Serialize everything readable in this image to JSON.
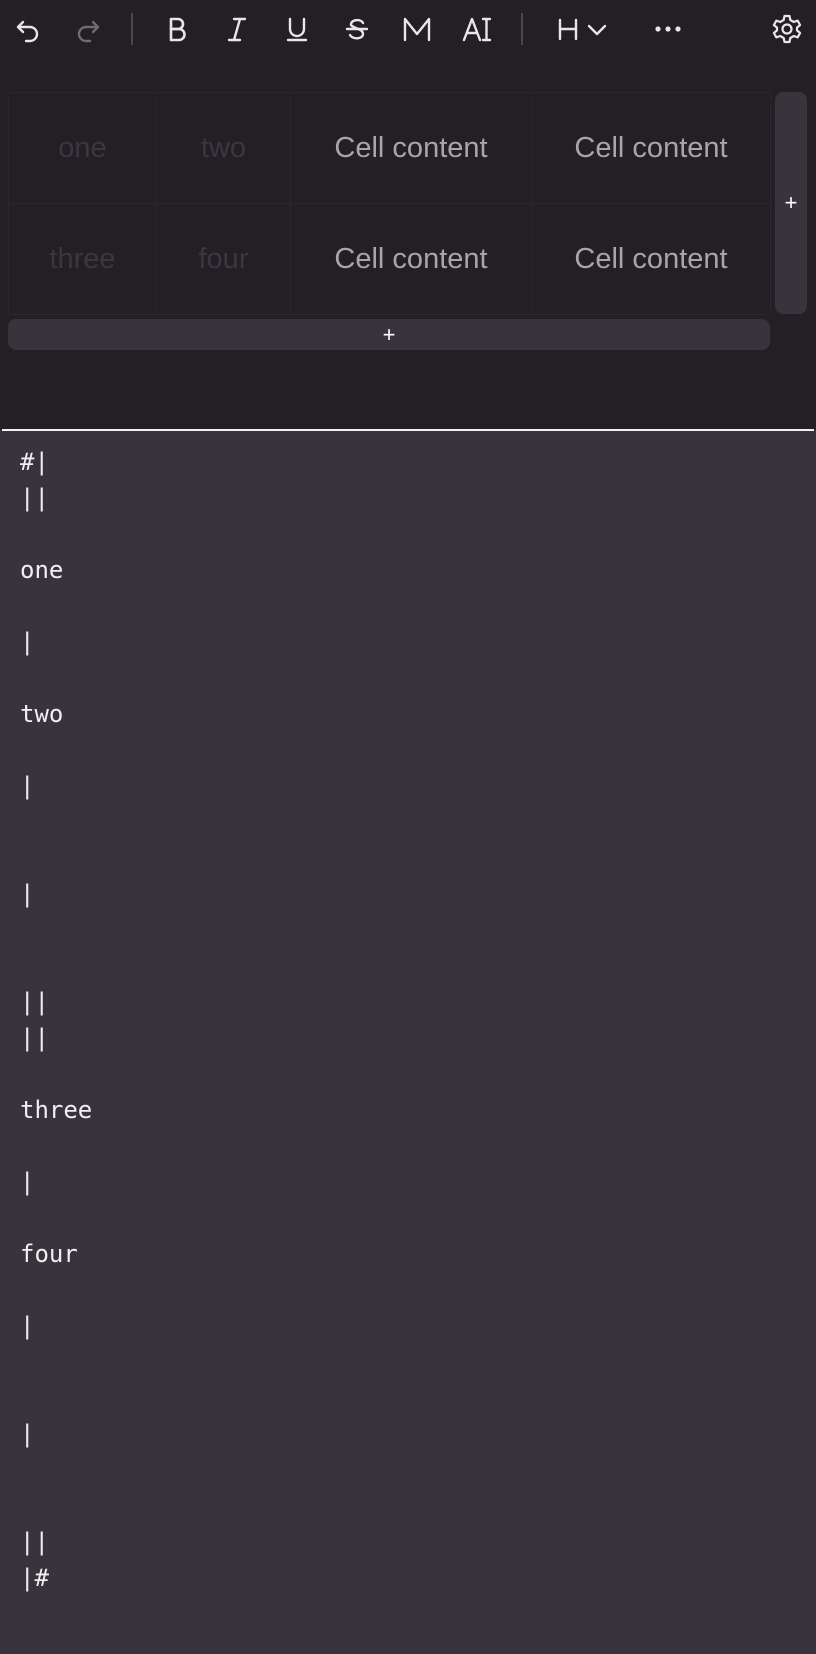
{
  "toolbar": {
    "icons": [
      "undo-icon",
      "redo-icon",
      "bold-icon",
      "italic-icon",
      "underline-icon",
      "strikethrough-icon",
      "monospace-icon",
      "text-style-icon",
      "heading-icon",
      "more-icon",
      "settings-icon"
    ],
    "bold_label": "B",
    "italic_label": "I",
    "underline_label": "U",
    "strike_label": "S",
    "mono_label": "M",
    "text_style_label": "A",
    "heading_label": "H",
    "more_label": "•••"
  },
  "table": {
    "rows": [
      [
        "one",
        "two",
        "Cell content",
        "Cell content"
      ],
      [
        "three",
        "four",
        "Cell content",
        "Cell content"
      ]
    ],
    "add_column_label": "+",
    "add_row_label": "+"
  },
  "source": {
    "lines": [
      "#|",
      "||",
      "one",
      "|",
      "two",
      "|",
      "|",
      "||",
      "||",
      "three",
      "|",
      "four",
      "|",
      "|",
      "||",
      "|#"
    ]
  },
  "colors": {
    "top_background": "#221f25",
    "source_background": "#38343b",
    "text": "#f1eff3",
    "faded_cell_text": "#3b3740",
    "cell_text": "#a8a4ac"
  }
}
